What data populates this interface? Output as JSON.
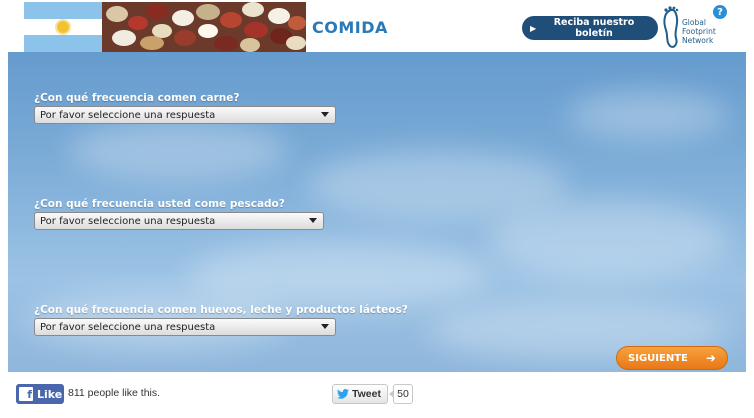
{
  "header": {
    "section_title": "COMIDA",
    "newsletter_label": "Reciba nuestro boletín",
    "org_name_lines": [
      "Global",
      "Footprint",
      "Network"
    ],
    "help_label": "?"
  },
  "questions": [
    {
      "text": "¿Con qué frecuencia comen carne?",
      "selected": "Por favor seleccione una respuesta"
    },
    {
      "text": "¿Con qué frecuencia usted come pescado?",
      "selected": "Por favor seleccione una respuesta"
    },
    {
      "text": "¿Con qué frecuencia comen huevos, leche y productos lácteos?",
      "selected": "Por favor seleccione una respuesta"
    }
  ],
  "next_label": "SIGUIENTE",
  "footer": {
    "fb_like_label": "Like",
    "fb_count_text": "811 people like this.",
    "tweet_label": "Tweet",
    "tweet_count": "50"
  },
  "colors": {
    "title_blue": "#2a7ab8",
    "newsletter_bg": "#1f4e79",
    "next_orange": "#f08c2a",
    "facebook_blue": "#4a67ad"
  },
  "icons": [
    "argentina-flag",
    "beans-photo",
    "footprint-logo-icon",
    "help-icon",
    "arrow-right-icon",
    "facebook-icon",
    "twitter-bird-icon",
    "dropdown-caret-icon"
  ]
}
